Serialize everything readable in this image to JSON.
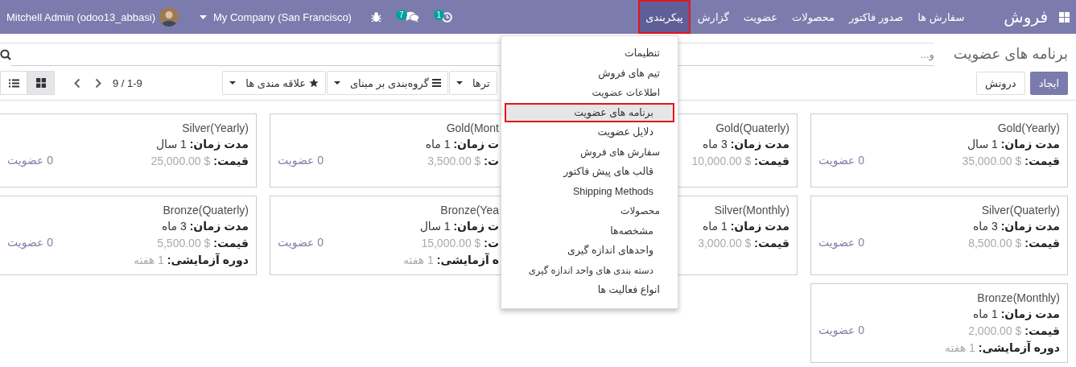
{
  "navbar": {
    "brand": "فروش",
    "menu": [
      {
        "label": "سفارش ها",
        "selected": false,
        "marked": false
      },
      {
        "label": "صدور فاکتور",
        "selected": false,
        "marked": false
      },
      {
        "label": "محصولات",
        "selected": false,
        "marked": false
      },
      {
        "label": "عضویت",
        "selected": false,
        "marked": false
      },
      {
        "label": "گزارش",
        "selected": false,
        "marked": false
      },
      {
        "label": "پیکربندی",
        "selected": true,
        "marked": true
      }
    ],
    "activity_count": "1",
    "chat_count": "7",
    "company": "My Company (San Francisco)",
    "user": "Mitchell Admin (odoo13_abbasi)"
  },
  "control_panel": {
    "title": "برنامه های عضویت",
    "search": {
      "placeholder": "و..."
    },
    "buttons": [
      {
        "label": "ایجاد",
        "kind": "primary"
      },
      {
        "label": "درونش",
        "kind": "secondary"
      }
    ],
    "search_options": [
      {
        "label": "ترها",
        "kind": "filter"
      },
      {
        "label": "گروه‌بندی بر مبنای",
        "kind": "groupby"
      },
      {
        "label": "علاقه مندی ها",
        "kind": "favorites"
      }
    ],
    "pager": "9 / 1-9",
    "views": [
      {
        "kind": "kanban",
        "selected": true
      },
      {
        "kind": "list",
        "selected": false
      }
    ]
  },
  "cards": [
    {
      "name": "Gold(Yearly)",
      "duration": {
        "label": "مدت زمان:",
        "value": "1 سال"
      },
      "price": {
        "label": "قیمت:",
        "value": "$ 35,000.00"
      },
      "count": "0 عضویت"
    },
    {
      "name": "Gold(Quaterly)",
      "duration": {
        "label": "مدت زمان:",
        "value": "3 ماه"
      },
      "price": {
        "label": "قیمت:",
        "value": "$ 10,000.00"
      }
    },
    {
      "name": "Gold(Mont",
      "duration": {
        "label": "ت زمان:",
        "value": "1 ماه"
      },
      "price": {
        "label": "ت:",
        "value": "$ 3,500.00"
      },
      "count": "0 عضویت"
    },
    {
      "name": "Silver(Yearly)",
      "duration": {
        "label": "مدت زمان:",
        "value": "1 سال"
      },
      "price": {
        "label": "قیمت:",
        "value": "$ 25,000.00"
      },
      "count": "0 عضویت"
    },
    {
      "name": "Silver(Quaterly)",
      "duration": {
        "label": "مدت زمان:",
        "value": "3 ماه"
      },
      "price": {
        "label": "قیمت:",
        "value": "$ 8,500.00"
      },
      "count": "0 عضویت"
    },
    {
      "name": "Silver(Monthly)",
      "duration": {
        "label": "مدت زمان:",
        "value": "1 ماه"
      },
      "price": {
        "label": "قیمت:",
        "value": "$ 3,000.00"
      }
    },
    {
      "name": "Bronze(Yea",
      "duration": {
        "label": "ت زمان:",
        "value": "1 سال"
      },
      "price": {
        "label": "ت:",
        "value": "$ 15,000.00"
      },
      "trial": {
        "label": "ه آزمایشی:",
        "value": "1 هفته"
      },
      "count": "0 عضویت"
    },
    {
      "name": "Bronze(Quaterly)",
      "duration": {
        "label": "مدت زمان:",
        "value": "3 ماه"
      },
      "price": {
        "label": "قیمت:",
        "value": "$ 5,500.00"
      },
      "trial": {
        "label": "دوره آزمایشی:",
        "value": "1 هفته"
      },
      "count": "0 عضویت"
    },
    {
      "name": "Bronze(Monthly)",
      "duration": {
        "label": "مدت زمان:",
        "value": "1 ماه"
      },
      "price": {
        "label": "قیمت:",
        "value": "$ 2,000.00"
      },
      "trial": {
        "label": "دوره آزمایشی:",
        "value": "1 هفته"
      },
      "count": "0 عضویت"
    }
  ],
  "config_menu": [
    {
      "label": "تنظیمات",
      "kind": "item",
      "selected": false,
      "marked": false
    },
    {
      "label": "تیم های فروش",
      "kind": "item",
      "selected": false,
      "marked": false
    },
    {
      "label": "اطلاعات عضویت",
      "kind": "header",
      "children": [
        {
          "label": "برنامه های عضویت",
          "selected": true,
          "marked": true
        },
        {
          "label": "دلایل عضویت",
          "selected": false,
          "marked": false
        }
      ]
    },
    {
      "label": "سفارش های فروش",
      "kind": "header",
      "children": [
        {
          "label": "قالب های پیش فاکتور",
          "selected": false,
          "marked": false
        },
        {
          "label": "Shipping Methods",
          "selected": false,
          "marked": false
        }
      ]
    },
    {
      "label": "محصولات",
      "kind": "header",
      "children": [
        {
          "label": "مشخصه‌ها",
          "selected": false,
          "marked": false
        },
        {
          "label": "واحدهای اندازه گیری",
          "selected": false,
          "marked": false
        },
        {
          "label": "دسته بندی های واحد اندازه گیری",
          "selected": false,
          "marked": false
        }
      ]
    },
    {
      "label": "انواع فعالیت ها",
      "kind": "item",
      "selected": false,
      "marked": false
    }
  ]
}
